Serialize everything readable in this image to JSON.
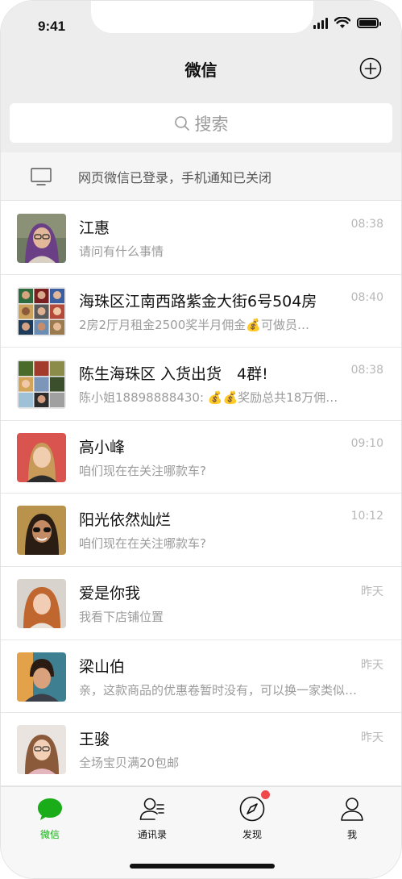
{
  "status_bar": {
    "time": "9:41"
  },
  "nav": {
    "title": "微信"
  },
  "search": {
    "placeholder": "搜索"
  },
  "login_banner": {
    "text": "网页微信已登录，手机通知已关闭"
  },
  "chats": [
    {
      "name": "江惠",
      "message": "请问有什么事情",
      "time": "08:38"
    },
    {
      "name": "海珠区江南西路紫金大街6号504房",
      "message": "2房2厅月租金2500奖半月佣金💰可做员…",
      "time": "08:40"
    },
    {
      "name": "陈生海珠区 入货出货　4群!",
      "message": "陈小姐18898888430: 💰💰奖励总共18万佣…",
      "time": "08:38"
    },
    {
      "name": "高小峰",
      "message": "咱们现在在关注哪款车?",
      "time": "09:10"
    },
    {
      "name": "阳光依然灿烂",
      "message": "咱们现在在关注哪款车?",
      "time": "10:12"
    },
    {
      "name": "爱是你我",
      "message": "我看下店铺位置",
      "time": "昨天"
    },
    {
      "name": "梁山伯",
      "message": "亲，这款商品的优惠卷暂时没有，可以换一家类似…",
      "time": "昨天"
    },
    {
      "name": "王骏",
      "message": "全场宝贝满20包邮",
      "time": "昨天"
    }
  ],
  "tabs": [
    {
      "label": "微信",
      "icon": "chat-bubble-icon",
      "active": true
    },
    {
      "label": "通讯录",
      "icon": "contacts-icon",
      "active": false
    },
    {
      "label": "发现",
      "icon": "compass-icon",
      "active": false,
      "badge": true
    },
    {
      "label": "我",
      "icon": "person-icon",
      "active": false
    }
  ],
  "colors": {
    "accent": "#1aad19",
    "badge": "#f0484a",
    "header_bg": "#ededed"
  }
}
